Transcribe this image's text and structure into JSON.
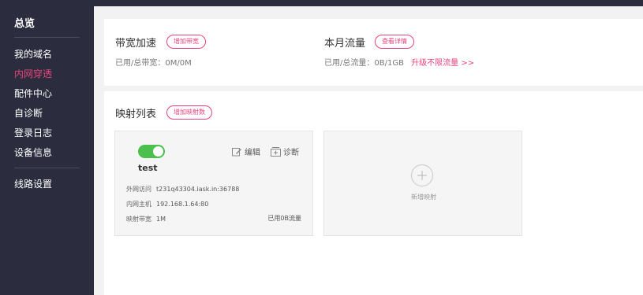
{
  "sidebar": {
    "title": "总览",
    "items": [
      {
        "label": "我的域名"
      },
      {
        "label": "内网穿透"
      },
      {
        "label": "配件中心"
      },
      {
        "label": "自诊断"
      },
      {
        "label": "登录日志"
      },
      {
        "label": "设备信息"
      },
      {
        "label": "线路设置"
      }
    ],
    "active_index": 1
  },
  "bandwidth": {
    "title": "带宽加速",
    "button": "增加带宽",
    "label": "已用/总带宽：",
    "value": "0M/0M"
  },
  "traffic": {
    "title": "本月流量",
    "button": "查看详情",
    "label": "已用/总流量：",
    "value": "0B/1GB",
    "upgrade_link": "升级不限流量 >>"
  },
  "mapping": {
    "title": "映射列表",
    "add_button": "增加映射数",
    "card": {
      "enabled": true,
      "edit": "编辑",
      "diagnose": "诊断",
      "name": "test",
      "external_label": "外网访问",
      "external_value": "t231q43304.iask.in:36788",
      "host_label": "内网主机",
      "host_value": "192.168.1.64:80",
      "bandwidth_label": "映射带宽",
      "bandwidth_value": "1M",
      "usage": "已用0B流量"
    },
    "add_card_label": "新增映射"
  },
  "colors": {
    "sidebar_bg": "#2b2d3e",
    "accent": "#e8437b",
    "toggle_on": "#4cc04c"
  }
}
